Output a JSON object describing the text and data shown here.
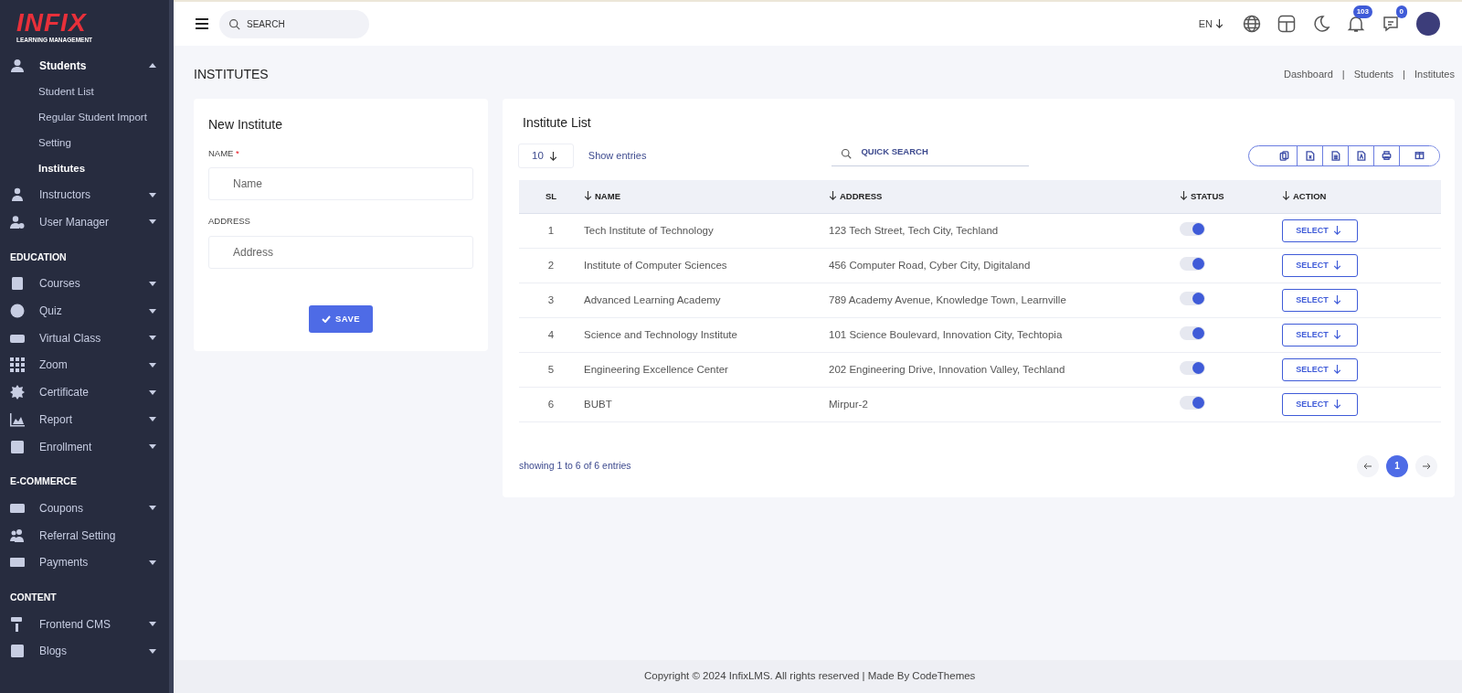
{
  "sidebar": {
    "logo": {
      "wordmark": "INFIX",
      "tagline": "LEARNING MANAGEMENT"
    },
    "items": [
      {
        "kind": "item",
        "label": "Students",
        "expanded": true,
        "children": [
          {
            "label": "Student List",
            "selected": false
          },
          {
            "label": "Regular Student Import",
            "selected": false
          },
          {
            "label": "Setting",
            "selected": false
          },
          {
            "label": "Institutes",
            "selected": true
          }
        ]
      },
      {
        "kind": "item",
        "label": "Instructors",
        "expanded": false
      },
      {
        "kind": "item",
        "label": "User Manager",
        "expanded": false
      },
      {
        "kind": "section",
        "label": "EDUCATION"
      },
      {
        "kind": "item",
        "label": "Courses",
        "expanded": false
      },
      {
        "kind": "item",
        "label": "Quiz",
        "expanded": false
      },
      {
        "kind": "item",
        "label": "Virtual Class",
        "expanded": false
      },
      {
        "kind": "item",
        "label": "Zoom",
        "expanded": false
      },
      {
        "kind": "item",
        "label": "Certificate",
        "expanded": false
      },
      {
        "kind": "item",
        "label": "Report",
        "expanded": false
      },
      {
        "kind": "item",
        "label": "Enrollment",
        "expanded": false
      },
      {
        "kind": "section",
        "label": "E-COMMERCE"
      },
      {
        "kind": "item",
        "label": "Coupons",
        "expanded": false
      },
      {
        "kind": "item",
        "label": "Referral Setting"
      },
      {
        "kind": "item",
        "label": "Payments",
        "expanded": false
      },
      {
        "kind": "section",
        "label": "CONTENT"
      },
      {
        "kind": "item",
        "label": "Frontend CMS",
        "expanded": false
      },
      {
        "kind": "item",
        "label": "Blogs",
        "expanded": false
      }
    ]
  },
  "header": {
    "search": {
      "placeholder": "SEARCH"
    },
    "language": "EN",
    "notifications": "103",
    "messages": "0"
  },
  "page": {
    "title": "INSTITUTES",
    "breadcrumbs": [
      {
        "label": "Dashboard"
      },
      {
        "separator": "|",
        "label": "Students"
      },
      {
        "separator": "|",
        "label": "Institutes"
      }
    ]
  },
  "form": {
    "title": "New Institute",
    "fields": [
      {
        "label": "NAME",
        "required_mark": "*",
        "placeholder": "Name"
      },
      {
        "label": "ADDRESS",
        "placeholder": "Address"
      }
    ],
    "save": "SAVE"
  },
  "list": {
    "title": "Institute List",
    "page_size": "10",
    "show_entries": "Show entries",
    "quick_search": {
      "placeholder": "QUICK SEARCH"
    },
    "columns": [
      {
        "label": "SL",
        "sortable": false
      },
      {
        "label": "NAME",
        "sortable": true
      },
      {
        "label": "ADDRESS",
        "sortable": true
      },
      {
        "label": "STATUS",
        "sortable": true
      },
      {
        "label": "ACTION",
        "sortable": true
      }
    ],
    "rows": [
      {
        "sl": "1",
        "name": "Tech Institute of Technology",
        "address": "123 Tech Street, Tech City, Techland",
        "on": true,
        "action": "SELECT"
      },
      {
        "sl": "2",
        "name": "Institute of Computer Sciences",
        "address": "456 Computer Road, Cyber City, Digitaland",
        "on": true,
        "action": "SELECT"
      },
      {
        "sl": "3",
        "name": "Advanced Learning Academy",
        "address": "789 Academy Avenue, Knowledge Town, Learnville",
        "on": true,
        "action": "SELECT"
      },
      {
        "sl": "4",
        "name": "Science and Technology Institute",
        "address": "101 Science Boulevard, Innovation City, Techtopia",
        "on": true,
        "action": "SELECT"
      },
      {
        "sl": "5",
        "name": "Engineering Excellence Center",
        "address": "202 Engineering Drive, Innovation Valley, Techland",
        "on": true,
        "action": "SELECT"
      },
      {
        "sl": "6",
        "name": "BUBT",
        "address": "Mirpur-2",
        "on": true,
        "action": "SELECT"
      }
    ],
    "info": "showing 1 to 6 of 6 entries",
    "pages": [
      {
        "label": "1",
        "selected": true
      }
    ]
  },
  "footer": "Copyright © 2024 InfixLMS. All rights reserved | Made By CodeThemes"
}
